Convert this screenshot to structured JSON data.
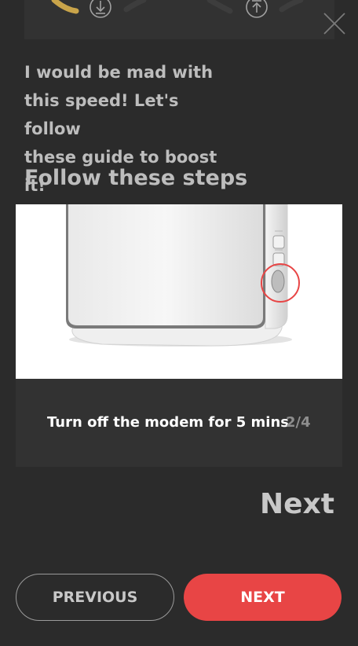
{
  "headline": "I would be mad with\nthis speed! Let's follow\nthese guide to boost it!",
  "section_title": "Follow these steps",
  "step": {
    "caption": "Turn off the modem for 5 mins",
    "counter": "2/4",
    "image": "modem-power-button"
  },
  "next_link": "Next",
  "buttons": {
    "previous": "PREVIOUS",
    "next": "NEXT"
  },
  "icons": {
    "download": "download-icon",
    "upload": "upload-icon",
    "close": "close-icon"
  },
  "colors": {
    "background": "#2b2b2b",
    "card": "#323232",
    "accent": "#e84545",
    "gauge_gold": "#c9a44a",
    "muted_text": "#bdbdbd"
  }
}
